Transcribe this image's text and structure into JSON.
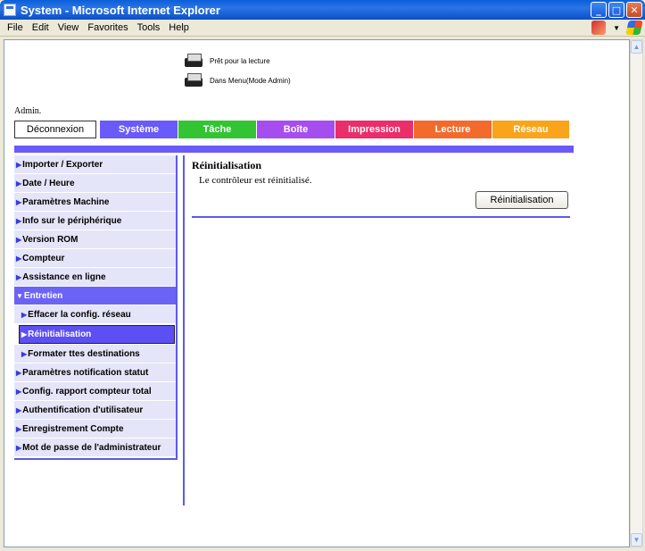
{
  "window": {
    "title": "System - Microsoft Internet Explorer"
  },
  "menu": [
    "File",
    "Edit",
    "View",
    "Favorites",
    "Tools",
    "Help"
  ],
  "status": {
    "line1": "Prêt pour la lecture",
    "line2": "Dans Menu(Mode Admin)"
  },
  "admin_label": "Admin.",
  "logout_label": "Déconnexion",
  "tabs": [
    {
      "label": "Système",
      "color": "#6a5af9"
    },
    {
      "label": "Tâche",
      "color": "#33c433"
    },
    {
      "label": "Boîte",
      "color": "#a64df0"
    },
    {
      "label": "Impression",
      "color": "#ea2d6b"
    },
    {
      "label": "Lecture",
      "color": "#f26b2c"
    },
    {
      "label": "Réseau",
      "color": "#f9a41a"
    }
  ],
  "sidebar": {
    "items": [
      "Importer / Exporter",
      "Date / Heure",
      "Paramètres Machine",
      "Info sur le périphérique",
      "Version ROM",
      "Compteur",
      "Assistance en ligne",
      "Entretien",
      "Effacer la config. réseau",
      "Réinitialisation",
      "Formater ttes destinations",
      "Paramètres notification statut",
      "Config. rapport compteur total",
      "Authentification d'utilisateur",
      "Enregistrement Compte",
      "Mot de passe de l'administrateur"
    ]
  },
  "content": {
    "title": "Réinitialisation",
    "message": "Le contrôleur est réinitialisé.",
    "button": "Réinitialisation"
  }
}
